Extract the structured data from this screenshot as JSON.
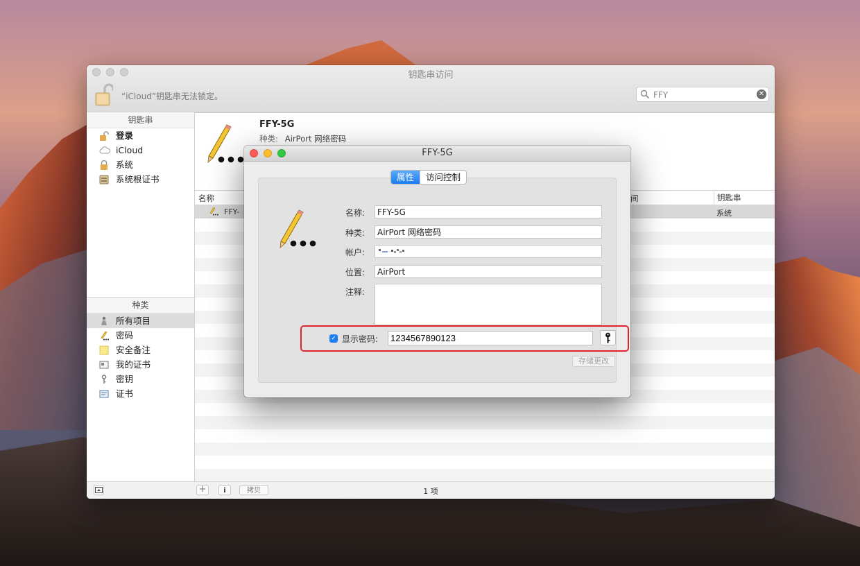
{
  "window": {
    "title": "钥匙串访问",
    "lock_status": "“iCloud”钥匙串无法锁定。"
  },
  "search": {
    "value": "FFY",
    "clear_glyph": "✕"
  },
  "sidebar": {
    "keychains_header": "钥匙串",
    "keychains": [
      {
        "label": "登录",
        "icon": "open-lock-icon"
      },
      {
        "label": "iCloud",
        "icon": "cloud-icon"
      },
      {
        "label": "系统",
        "icon": "lock-icon"
      },
      {
        "label": "系统根证书",
        "icon": "certificate-cabinet-icon"
      }
    ],
    "categories_header": "种类",
    "categories": [
      {
        "label": "所有项目",
        "icon": "people-icon"
      },
      {
        "label": "密码",
        "icon": "pencil-password-icon"
      },
      {
        "label": "安全备注",
        "icon": "note-icon"
      },
      {
        "label": "我的证书",
        "icon": "my-certificate-icon"
      },
      {
        "label": "密钥",
        "icon": "key-icon"
      },
      {
        "label": "证书",
        "icon": "certificate-icon"
      }
    ]
  },
  "detail": {
    "title": "FFY-5G",
    "kind_label": "种类:",
    "kind_value": "AirPort 网络密码"
  },
  "table": {
    "columns": [
      "名称",
      "间",
      "钥匙串"
    ],
    "rows": [
      {
        "name": "FFY-",
        "keychain": "系统"
      }
    ]
  },
  "bottombar": {
    "add": "+",
    "info": "i",
    "copy": "拷贝",
    "count": "1 项"
  },
  "dialog": {
    "title": "FFY-5G",
    "tabs": [
      "属性",
      "访问控制"
    ],
    "fields": {
      "name_label": "名称:",
      "name_value": "FFY-5G",
      "kind_label": "种类:",
      "kind_value": "AirPort 网络密码",
      "account_label": "帐户:",
      "location_label": "位置:",
      "location_value": "AirPort",
      "notes_label": "注释:"
    },
    "show_password_label": "显示密码:",
    "password_value": "1234567890123",
    "checkbox_glyph": "✓",
    "save_button": "存储更改"
  },
  "colors": {
    "highlight": "#e2232a",
    "accent": "#1a7cf0"
  }
}
